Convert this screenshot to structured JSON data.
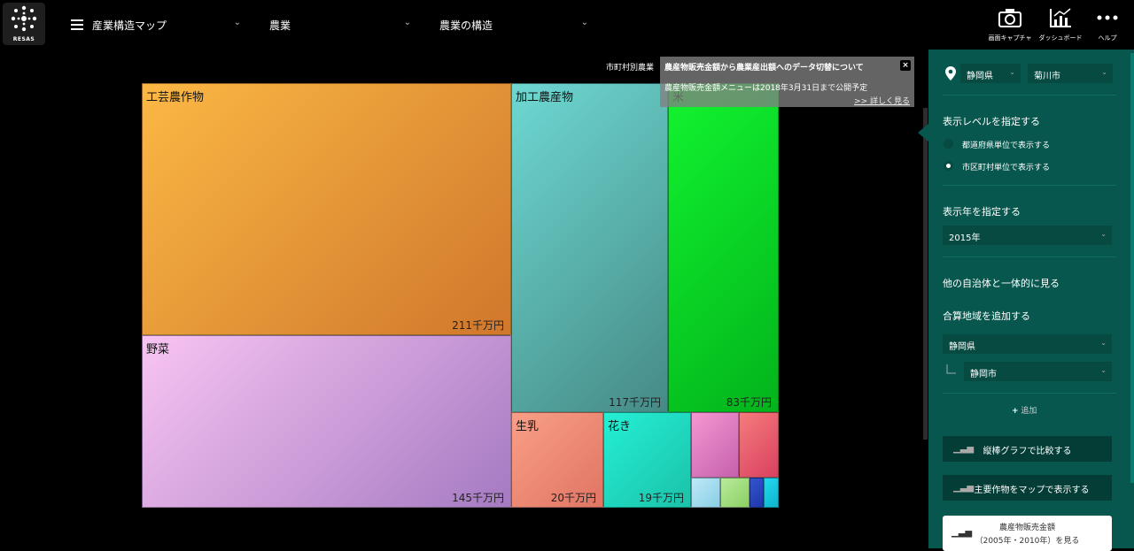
{
  "header": {
    "logo_text": "RESAS",
    "menu1": "産業構造マップ",
    "menu2": "農業",
    "menu3": "農業の構造",
    "tools": [
      {
        "label": "画面キャプチャ",
        "icon": "camera-icon"
      },
      {
        "label": "ダッシュボード",
        "icon": "dashboard-chart-icon"
      },
      {
        "label": "ヘルプ",
        "icon": "more-dots-icon"
      }
    ]
  },
  "chart": {
    "title_partial": "市町村別農業",
    "cells": [
      {
        "name": "工芸農作物",
        "value": "211千万円",
        "color_from": "#fbb844",
        "color_to": "#d0772c"
      },
      {
        "name": "野菜",
        "value": "145千万円",
        "color_from": "#f8c4f2",
        "color_to": "#a57ac2"
      },
      {
        "name": "加工農産物",
        "value": "117千万円",
        "color_from": "#6ed8d2",
        "color_to": "#468a86"
      },
      {
        "name": "米",
        "value": "83千万円",
        "color_from": "#11f530",
        "color_to": "#03b31b"
      },
      {
        "name": "生乳",
        "value": "20千万円",
        "color_from": "#f99f87",
        "color_to": "#e07563"
      },
      {
        "name": "花き",
        "value": "19千万円",
        "color_from": "#24efd6",
        "color_to": "#1bc2a8"
      }
    ],
    "small_cells": [
      {
        "color_from": "#f598d0",
        "color_to": "#c560ae"
      },
      {
        "color_from": "#f57c7c",
        "color_to": "#d94060"
      },
      {
        "color_from": "#bfe8f8",
        "color_to": "#88cfe4"
      },
      {
        "color_from": "#b8eb9b",
        "color_to": "#8ccf64"
      },
      {
        "color_from": "#3355d0",
        "color_to": "#1f36a8"
      },
      {
        "color_from": "#22d9ef",
        "color_to": "#0eb4cc"
      }
    ]
  },
  "notice": {
    "title": "農産物販売金額から農業産出額へのデータ切替について",
    "close": "×",
    "body": "農産物販売金額メニューは2018年3月31日まで公開予定",
    "link": ">> 詳しく見る"
  },
  "panel": {
    "prefecture": "静岡県",
    "city": "菊川市",
    "level_heading": "表示レベルを指定する",
    "level_options": [
      "都道府県単位で表示する",
      "市区町村単位で表示する"
    ],
    "level_selected": 1,
    "year_heading": "表示年を指定する",
    "year": "2015年",
    "integrate_heading": "他の自治体と一体的に見る",
    "add_area_heading": "合算地域を追加する",
    "add_pref": "静岡県",
    "add_city": "静岡市",
    "add_label": "追加",
    "btn_compare": "縦棒グラフで比較する",
    "btn_map": "主要作物をマップで表示する",
    "white_line1": "農産物販売金額",
    "white_line2": "（2005年・2010年）を見る"
  }
}
